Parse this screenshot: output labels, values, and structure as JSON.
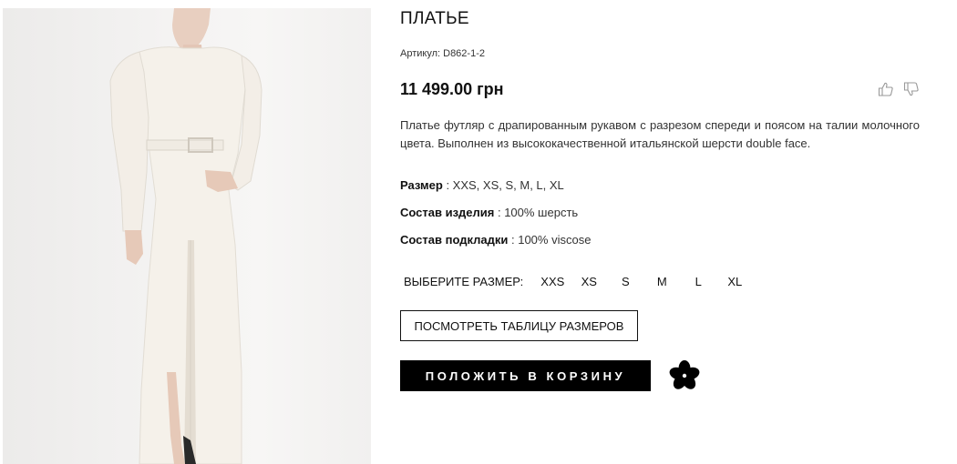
{
  "product": {
    "title": "ПЛАТЬЕ",
    "sku": "Артикул: D862-1-2",
    "price": "11 499.00 грн",
    "description": "Платье футляр с драпированным рукавом с разрезом спереди и поясом на талии молочного цвета. Выполнен из высококачественной итальянской шерсти double face.",
    "properties": [
      {
        "name": "Размер",
        "value": " : XXS, XS, S, M, L, XL"
      },
      {
        "name": "Состав изделия",
        "value": " : 100% шерсть"
      },
      {
        "name": "Состав подкладки",
        "value": " : 100% viscose"
      }
    ],
    "size_selector": {
      "label": "ВЫБЕРИТЕ РАЗМЕР:",
      "options": [
        "XXS",
        "XS",
        "S",
        "M",
        "L",
        "XL"
      ]
    },
    "size_table_button": "ПОСМОТРЕТЬ ТАБЛИЦУ РАЗМЕРОВ",
    "add_to_cart_button": "ПОЛОЖИТЬ В КОРЗИНУ"
  },
  "icons": {
    "like": "thumbs-up-icon",
    "dislike": "thumbs-down-icon",
    "favorite": "flower-favorite-icon"
  },
  "colors": {
    "cart_button_bg": "#000000",
    "text": "#111111"
  }
}
